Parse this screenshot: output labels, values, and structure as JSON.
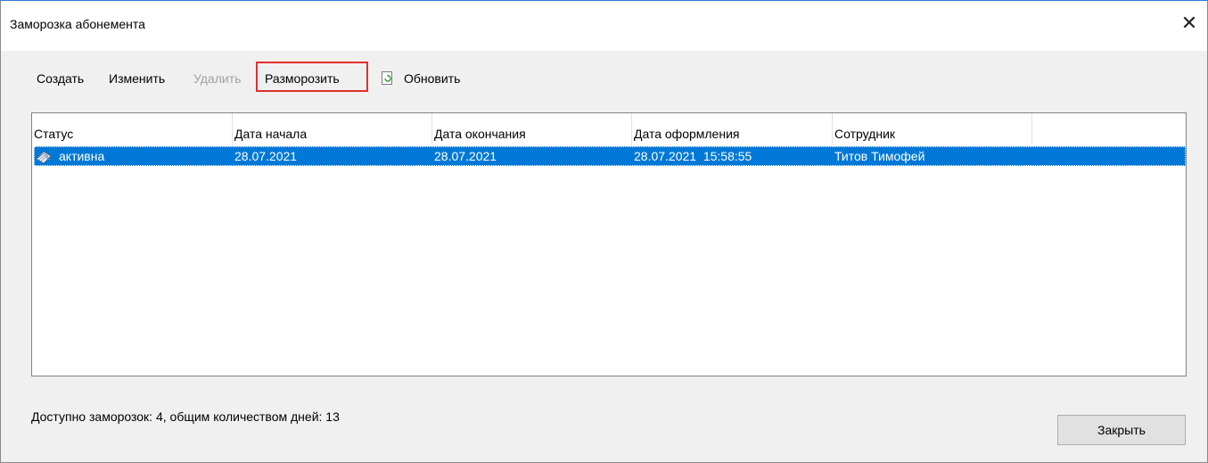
{
  "window": {
    "title": "Заморозка абонемента",
    "close_glyph": "✕"
  },
  "toolbar": {
    "create_label": "Создать",
    "edit_label": "Изменить",
    "delete_label": "Удалить",
    "unfreeze_label": "Разморозить",
    "refresh_label": "Обновить",
    "refresh_icon": "refresh-document-icon",
    "highlight_color": "#e0302c"
  },
  "grid": {
    "columns": [
      "Статус",
      "Дата начала",
      "Дата окончания",
      "Дата оформления",
      "Сотрудник",
      ""
    ],
    "rows": [
      {
        "icon": "freeze-record-icon",
        "status": "активна",
        "start_date": "28.07.2021",
        "end_date": "28.07.2021",
        "issued": "28.07.2021  15:58:55",
        "employee": "Титов Тимофей",
        "selected": true
      }
    ],
    "selection_color": "#0078d7"
  },
  "footer": {
    "summary": "Доступно заморозок: 4, общим количеством дней: 13",
    "close_button": "Закрыть"
  }
}
